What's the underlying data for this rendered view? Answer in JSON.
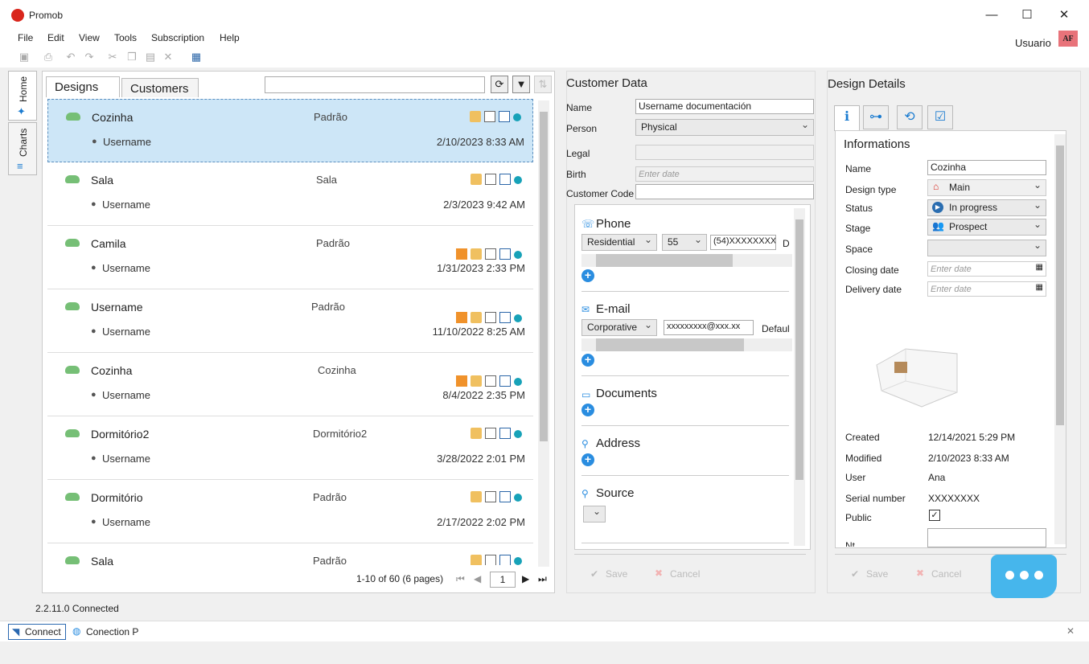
{
  "window": {
    "title": "Promob",
    "minimize": "—",
    "maximize": "☐",
    "close": "✕"
  },
  "menu": [
    "File",
    "Edit",
    "View",
    "Tools",
    "Subscription",
    "Help"
  ],
  "user": {
    "label": "Usuario",
    "badge": "AF"
  },
  "vtabs": [
    "Home",
    "Charts"
  ],
  "list": {
    "tabs": [
      "Designs",
      "Customers"
    ],
    "search_value": "",
    "rows": [
      {
        "name": "Cozinha",
        "type": "Padrão",
        "user": "Username",
        "date": "2/10/2023 8:33 AM",
        "person": false,
        "selected": true
      },
      {
        "name": "Sala",
        "type": "Sala",
        "user": "Username",
        "date": "2/3/2023 9:42 AM",
        "person": false,
        "selected": false
      },
      {
        "name": "Camila",
        "type": "Padrão",
        "user": "Username",
        "date": "1/31/2023 2:33 PM",
        "person": true,
        "selected": false
      },
      {
        "name": "Username",
        "type": "Padrão",
        "user": "Username",
        "date": "11/10/2022 8:25 AM",
        "person": true,
        "selected": false
      },
      {
        "name": "Cozinha",
        "type": "Cozinha",
        "user": "Username",
        "date": "8/4/2022 2:35 PM",
        "person": true,
        "selected": false
      },
      {
        "name": "Dormitório2",
        "type": "Dormitório2",
        "user": "Username",
        "date": "3/28/2022 2:01 PM",
        "person": false,
        "selected": false
      },
      {
        "name": "Dormitório",
        "type": "Padrão",
        "user": "Username",
        "date": "2/17/2022 2:02 PM",
        "person": false,
        "selected": false
      },
      {
        "name": "Sala",
        "type": "Padrão",
        "user": "",
        "date": "",
        "person": false,
        "selected": false
      }
    ],
    "pager": "1-10 of 60 (6 pages)",
    "page": "1"
  },
  "customer": {
    "title": "Customer Data",
    "name_label": "Name",
    "name_value": "Username documentación",
    "person_label": "Person",
    "person_value": "Physical",
    "legal_label": "Legal",
    "birth_label": "Birth",
    "birth_placeholder": "Enter date",
    "code_label": "Customer Code",
    "phone_title": "Phone",
    "phone_type": "Residential",
    "phone_code": "55",
    "phone_number": "(54)XXXXXXXX",
    "phone_trail": "D",
    "email_title": "E-mail",
    "email_type": "Corporative",
    "email_value": "xxxxxxxxx@xxx.xx",
    "email_default": "Defaul",
    "documents_title": "Documents",
    "address_title": "Address",
    "source_title": "Source",
    "save": "Save",
    "cancel": "Cancel"
  },
  "design": {
    "title": "Design Details",
    "info_title": "Informations",
    "name_label": "Name",
    "name_value": "Cozinha",
    "type_label": "Design type",
    "type_value": "Main",
    "status_label": "Status",
    "status_value": "In progress",
    "stage_label": "Stage",
    "stage_value": "Prospect",
    "space_label": "Space",
    "closing_label": "Closing date",
    "closing_placeholder": "Enter date",
    "delivery_label": "Delivery date",
    "delivery_placeholder": "Enter date",
    "created_label": "Created",
    "created_value": "12/14/2021 5:29 PM",
    "modified_label": "Modified",
    "modified_value": "2/10/2023 8:33 AM",
    "user_label": "User",
    "user_value": "Ana",
    "serial_label": "Serial number",
    "serial_value": "XXXXXXXX",
    "public_label": "Public",
    "notes_label": "Nt",
    "save": "Save",
    "cancel": "Cancel"
  },
  "status": {
    "text": "2.2.11.0 Connected",
    "connect": "Connect",
    "connection": "Conection P"
  },
  "colors": {
    "accent": "#2a8de0",
    "selection": "#cde6f7",
    "cloud": "#76bf76",
    "chat": "#46b6ec"
  }
}
